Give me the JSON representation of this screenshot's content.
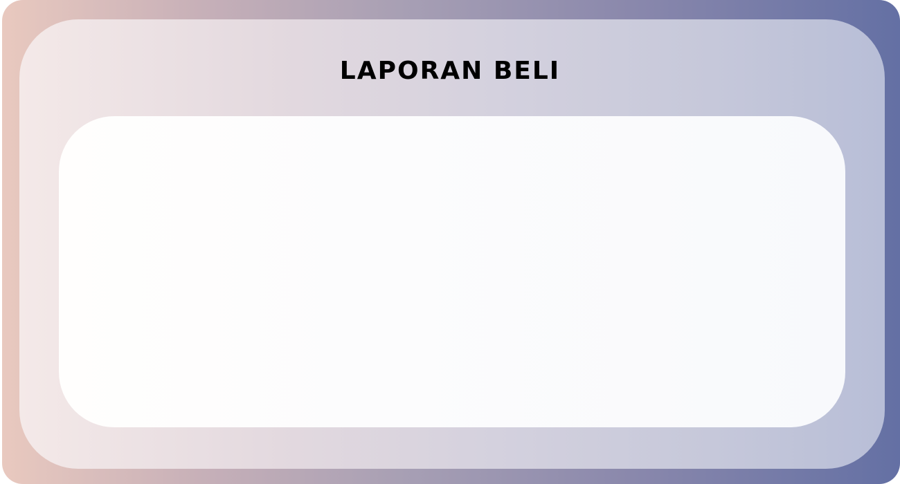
{
  "header": {
    "title": "LAPORAN BELI"
  },
  "colors": {
    "frame_gradient_start": "#e9c9bf",
    "frame_gradient_end": "#6470a4",
    "panel_gradient_start": "#f4e9e8",
    "panel_gradient_end": "#b8bed7",
    "card_background": "#fcfcfd",
    "title_color": "#000000"
  }
}
